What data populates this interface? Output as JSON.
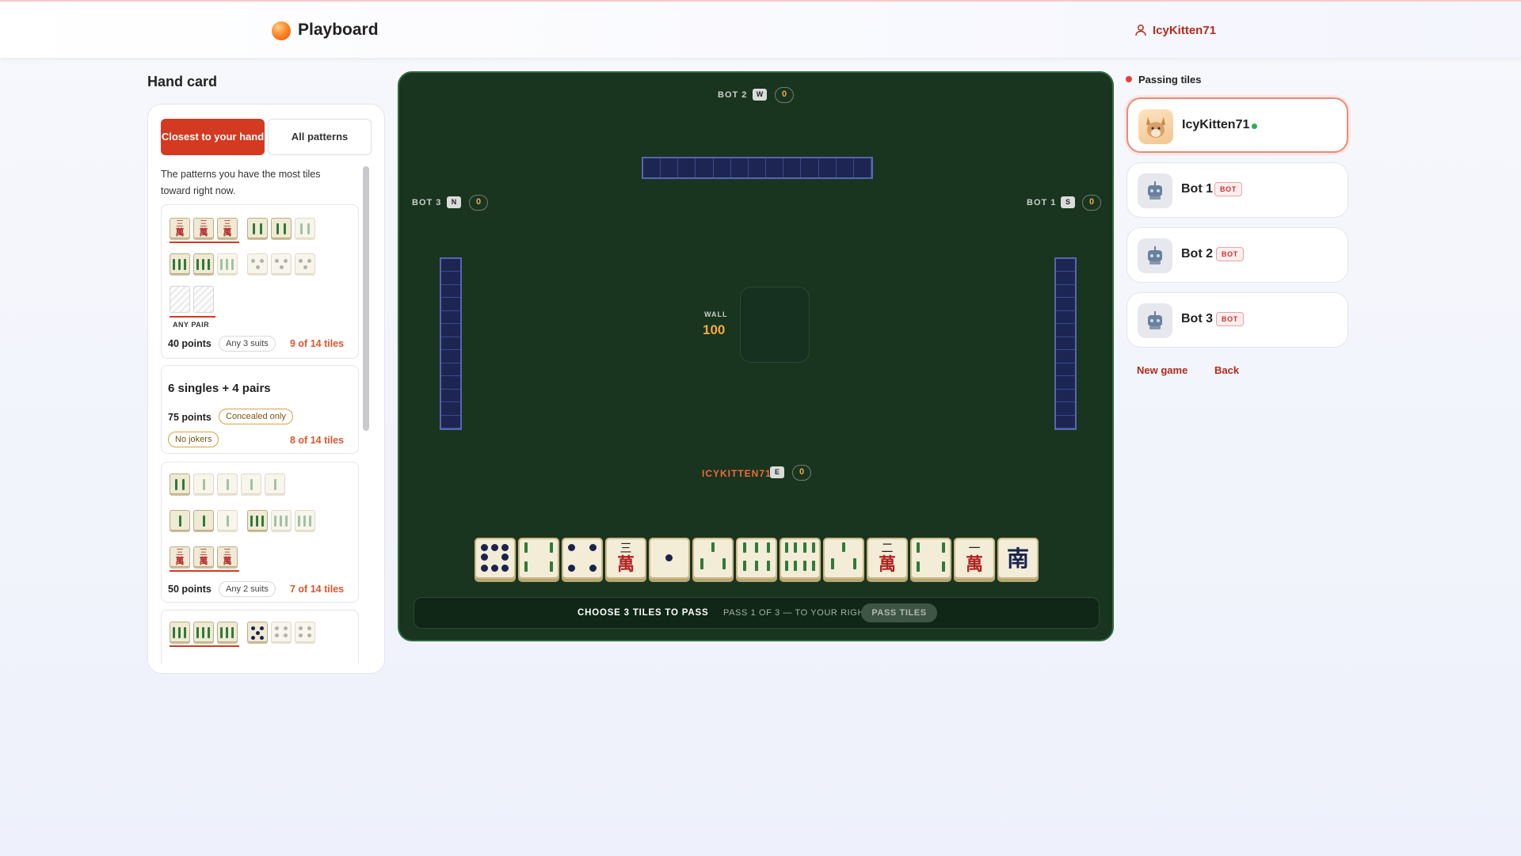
{
  "header": {
    "brand": "Playboard",
    "username": "IcyKitten71"
  },
  "hand_card": {
    "title": "Hand card",
    "tabs": [
      {
        "label": "Closest to your hand",
        "active": true
      },
      {
        "label": "All patterns",
        "active": false
      }
    ],
    "description": "The patterns you have the most tiles toward right now.",
    "patterns": [
      {
        "name": "",
        "points": "40 points",
        "chips": [
          "Any 3 suits"
        ],
        "count": "9 of 14 tiles",
        "any_pair_label": "ANY PAIR"
      },
      {
        "name": "6 singles + 4 pairs",
        "points": "75 points",
        "chips": [
          "Concealed only",
          "No jokers"
        ],
        "count": "8 of 14 tiles"
      },
      {
        "name": "",
        "points": "50 points",
        "chips": [
          "Any 2 suits"
        ],
        "count": "7 of 14 tiles"
      }
    ]
  },
  "table": {
    "seats": {
      "top": {
        "name": "BOT 2",
        "wind": "W",
        "score": "0"
      },
      "left": {
        "name": "BOT 3",
        "wind": "N",
        "score": "0"
      },
      "right": {
        "name": "BOT 1",
        "wind": "S",
        "score": "0"
      },
      "bottom": {
        "name": "ICYKITTEN71",
        "wind": "E",
        "score": "0"
      }
    },
    "wall_label": "WALL",
    "wall_count": "100",
    "hand_glyphs": {
      "wan": "萬",
      "one": "一",
      "two": "二",
      "three": "三",
      "south": "南"
    },
    "instruction": "CHOOSE 3 TILES TO PASS",
    "pass_info": "PASS 1 OF 3 — TO YOUR RIGHT",
    "pass_button": "PASS TILES"
  },
  "sidebar": {
    "status": "Passing tiles",
    "players": [
      {
        "name": "IcyKitten71",
        "bot": false,
        "active": true
      },
      {
        "name": "Bot 1",
        "bot": true,
        "badge": "BOT"
      },
      {
        "name": "Bot 2",
        "bot": true,
        "badge": "BOT"
      },
      {
        "name": "Bot 3",
        "bot": true,
        "badge": "BOT"
      }
    ],
    "new_game": "New game",
    "back": "Back"
  },
  "colors": {
    "accent": "#d33a21",
    "felt": "#19341f",
    "rack": "#1d2552",
    "score": "#f2a93b"
  }
}
